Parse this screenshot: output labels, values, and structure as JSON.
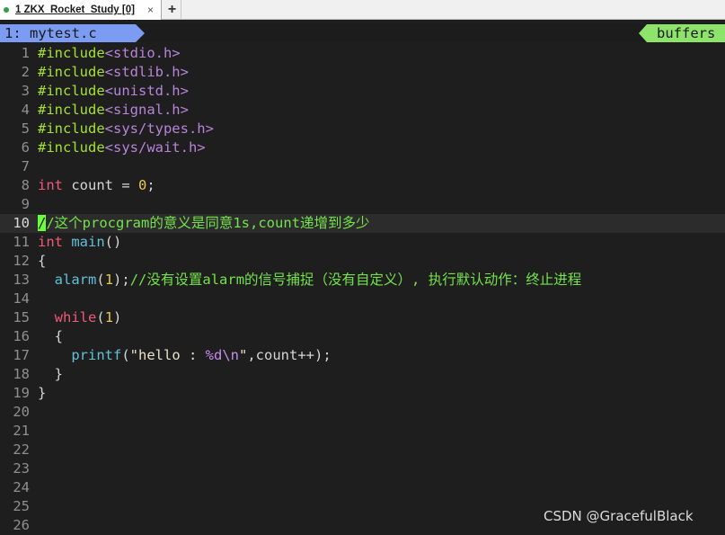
{
  "tabbar": {
    "tab_title": "1 ZKX_Rocket_Study [0]",
    "close_glyph": "×",
    "new_tab_glyph": "+",
    "status_dot_color": "#2ea043"
  },
  "buffer_line": {
    "current_buffer": "1: mytest.c",
    "label": "buffers",
    "current_color": "#7b9cf2",
    "label_color": "#8ee36b"
  },
  "editor": {
    "cursor_line": "10",
    "lines": [
      {
        "num": "1",
        "parts": [
          {
            "t": "#include",
            "c": "t-pp"
          },
          {
            "t": "<stdio.h>",
            "c": "t-inc"
          }
        ]
      },
      {
        "num": "2",
        "parts": [
          {
            "t": "#include",
            "c": "t-pp"
          },
          {
            "t": "<stdlib.h>",
            "c": "t-inc"
          }
        ]
      },
      {
        "num": "3",
        "parts": [
          {
            "t": "#include",
            "c": "t-pp"
          },
          {
            "t": "<unistd.h>",
            "c": "t-inc"
          }
        ]
      },
      {
        "num": "4",
        "parts": [
          {
            "t": "#include",
            "c": "t-pp"
          },
          {
            "t": "<signal.h>",
            "c": "t-inc"
          }
        ]
      },
      {
        "num": "5",
        "parts": [
          {
            "t": "#include",
            "c": "t-pp"
          },
          {
            "t": "<sys/types.h>",
            "c": "t-inc"
          }
        ]
      },
      {
        "num": "6",
        "parts": [
          {
            "t": "#include",
            "c": "t-pp"
          },
          {
            "t": "<sys/wait.h>",
            "c": "t-inc"
          }
        ]
      },
      {
        "num": "7",
        "parts": []
      },
      {
        "num": "8",
        "parts": [
          {
            "t": "int",
            "c": "t-type"
          },
          {
            "t": " count = ",
            "c": ""
          },
          {
            "t": "0",
            "c": "t-num"
          },
          {
            "t": ";",
            "c": ""
          }
        ]
      },
      {
        "num": "9",
        "parts": []
      },
      {
        "num": "10",
        "parts": [
          {
            "t": "/",
            "c": "cursor"
          },
          {
            "t": "/这个procgram的意义是同意1s,count递增到多少",
            "c": "t-cm"
          }
        ]
      },
      {
        "num": "11",
        "parts": [
          {
            "t": "int",
            "c": "t-type"
          },
          {
            "t": " ",
            "c": ""
          },
          {
            "t": "main",
            "c": "t-fn"
          },
          {
            "t": "()",
            "c": ""
          }
        ]
      },
      {
        "num": "12",
        "parts": [
          {
            "t": "{",
            "c": ""
          }
        ]
      },
      {
        "num": "13",
        "parts": [
          {
            "t": "  ",
            "c": ""
          },
          {
            "t": "alarm",
            "c": "t-fn"
          },
          {
            "t": "(",
            "c": ""
          },
          {
            "t": "1",
            "c": "t-num"
          },
          {
            "t": ");",
            "c": ""
          },
          {
            "t": "//没有设置alarm的信号捕捉（没有自定义）, 执行默认动作：终止进程",
            "c": "t-cm"
          }
        ]
      },
      {
        "num": "14",
        "parts": []
      },
      {
        "num": "15",
        "parts": [
          {
            "t": "  ",
            "c": ""
          },
          {
            "t": "while",
            "c": "t-kw"
          },
          {
            "t": "(",
            "c": ""
          },
          {
            "t": "1",
            "c": "t-num"
          },
          {
            "t": ")",
            "c": ""
          }
        ]
      },
      {
        "num": "16",
        "parts": [
          {
            "t": "  {",
            "c": ""
          }
        ]
      },
      {
        "num": "17",
        "parts": [
          {
            "t": "    ",
            "c": ""
          },
          {
            "t": "printf",
            "c": "t-fn"
          },
          {
            "t": "(",
            "c": ""
          },
          {
            "t": "\"hello : ",
            "c": "t-str"
          },
          {
            "t": "%d\\n",
            "c": "t-esc"
          },
          {
            "t": "\"",
            "c": "t-str"
          },
          {
            "t": ",count++);",
            "c": ""
          }
        ]
      },
      {
        "num": "18",
        "parts": [
          {
            "t": "  }",
            "c": ""
          }
        ]
      },
      {
        "num": "19",
        "parts": [
          {
            "t": "}",
            "c": ""
          }
        ]
      },
      {
        "num": "20",
        "parts": []
      },
      {
        "num": "21",
        "parts": []
      },
      {
        "num": "22",
        "parts": []
      },
      {
        "num": "23",
        "parts": []
      },
      {
        "num": "24",
        "parts": []
      },
      {
        "num": "25",
        "parts": []
      },
      {
        "num": "26",
        "parts": []
      }
    ]
  },
  "watermark": "CSDN @GracefulBlack"
}
